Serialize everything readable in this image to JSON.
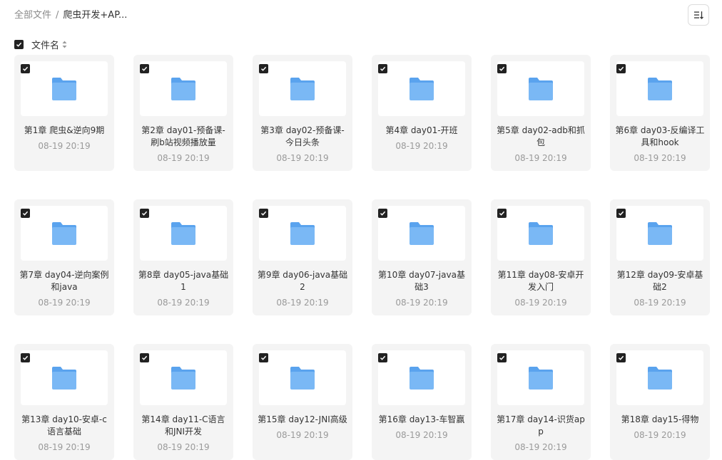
{
  "breadcrumb": {
    "root": "全部文件",
    "separator": "/",
    "current": "爬虫开发+AP..."
  },
  "header": {
    "column_label": "文件名",
    "sort_icon": "sort-icon"
  },
  "colors": {
    "folder_main": "#7ab8f5",
    "folder_tab": "#5aa3ee",
    "card_bg": "#f4f4f4",
    "checkbox": "#222222"
  },
  "files": [
    {
      "name": "第1章 爬虫&逆向9期",
      "date": "08-19 20:19"
    },
    {
      "name": "第2章 day01-预备课-刷b站视频播放量",
      "date": "08-19 20:19"
    },
    {
      "name": "第3章 day02-预备课-今日头条",
      "date": "08-19 20:19"
    },
    {
      "name": "第4章 day01-开班",
      "date": "08-19 20:19"
    },
    {
      "name": "第5章 day02-adb和抓包",
      "date": "08-19 20:19"
    },
    {
      "name": "第6章 day03-反编译工具和hook",
      "date": "08-19 20:19"
    },
    {
      "name": "第7章 day04-逆向案例和java",
      "date": "08-19 20:19"
    },
    {
      "name": "第8章 day05-java基础1",
      "date": "08-19 20:19"
    },
    {
      "name": "第9章 day06-java基础2",
      "date": "08-19 20:19"
    },
    {
      "name": "第10章 day07-java基础3",
      "date": "08-19 20:19"
    },
    {
      "name": "第11章 day08-安卓开发入门",
      "date": "08-19 20:19"
    },
    {
      "name": "第12章 day09-安卓基础2",
      "date": "08-19 20:19"
    },
    {
      "name": "第13章 day10-安卓-c语言基础",
      "date": "08-19 20:19"
    },
    {
      "name": "第14章 day11-C语言和JNI开发",
      "date": "08-19 20:19"
    },
    {
      "name": "第15章 day12-JNI高级",
      "date": "08-19 20:19"
    },
    {
      "name": "第16章 day13-车智赢",
      "date": "08-19 20:19"
    },
    {
      "name": "第17章 day14-识货app",
      "date": "08-19 20:19"
    },
    {
      "name": "第18章 day15-得物",
      "date": "08-19 20:19"
    }
  ]
}
